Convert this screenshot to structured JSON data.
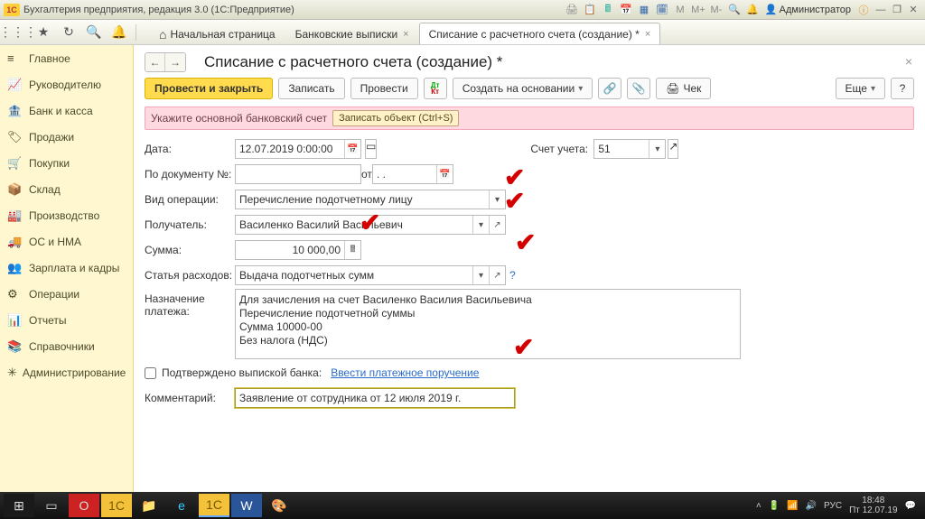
{
  "titlebar": {
    "app_logo": "1C",
    "app_title": "Бухгалтерия предприятия, редакция 3.0  (1С:Предприятие)",
    "user": "Администратор"
  },
  "tabs": {
    "home": "Начальная страница",
    "bank": "Банковские выписки",
    "current": "Списание с расчетного счета (создание) *"
  },
  "sidebar": {
    "items": [
      {
        "icon": "≡",
        "label": "Главное"
      },
      {
        "icon": "📈",
        "label": "Руководителю"
      },
      {
        "icon": "🏦",
        "label": "Банк и касса"
      },
      {
        "icon": "🏷",
        "label": "Продажи"
      },
      {
        "icon": "🛒",
        "label": "Покупки"
      },
      {
        "icon": "📦",
        "label": "Склад"
      },
      {
        "icon": "🏭",
        "label": "Производство"
      },
      {
        "icon": "🚚",
        "label": "ОС и НМА"
      },
      {
        "icon": "👥",
        "label": "Зарплата и кадры"
      },
      {
        "icon": "⚙",
        "label": "Операции"
      },
      {
        "icon": "📊",
        "label": "Отчеты"
      },
      {
        "icon": "📚",
        "label": "Справочники"
      },
      {
        "icon": "✳",
        "label": "Администрирование"
      }
    ]
  },
  "page": {
    "title": "Списание с расчетного счета (создание) *"
  },
  "toolbar": {
    "post_close": "Провести и закрыть",
    "save": "Записать",
    "post": "Провести",
    "create_based": "Создать на основании",
    "check": "Чек",
    "more": "Еще"
  },
  "warning": {
    "text": "Укажите основной банковский счет",
    "tooltip": "Записать объект (Ctrl+S)"
  },
  "form": {
    "date_label": "Дата:",
    "date_value": "12.07.2019  0:00:00",
    "account_label": "Счет учета:",
    "account_value": "51",
    "docnum_label": "По документу №:",
    "docnum_value": "",
    "docnum_from": "от:",
    "docnum_date": ".  .",
    "optype_label": "Вид операции:",
    "optype_value": "Перечисление подотчетному лицу",
    "payee_label": "Получатель:",
    "payee_value": "Василенко Василий Васильевич",
    "sum_label": "Сумма:",
    "sum_value": "10 000,00",
    "expense_label": "Статья расходов:",
    "expense_value": "Выдача подотчетных сумм",
    "purpose_label": "Назначение платежа:",
    "purpose_value": "Для зачисления на счет Василенко Василия Васильевича\nПеречисление подотчетной суммы\nСумма 10000-00\nБез налога (НДС)",
    "confirmed_label": "Подтверждено выпиской банка:",
    "enter_payment": "Ввести платежное поручение",
    "comment_label": "Комментарий:",
    "comment_value": "Заявление от сотрудника от 12 июля 2019 г."
  },
  "taskbar": {
    "lang": "РУС",
    "time": "18:48",
    "date": "Пт 12.07.19"
  }
}
